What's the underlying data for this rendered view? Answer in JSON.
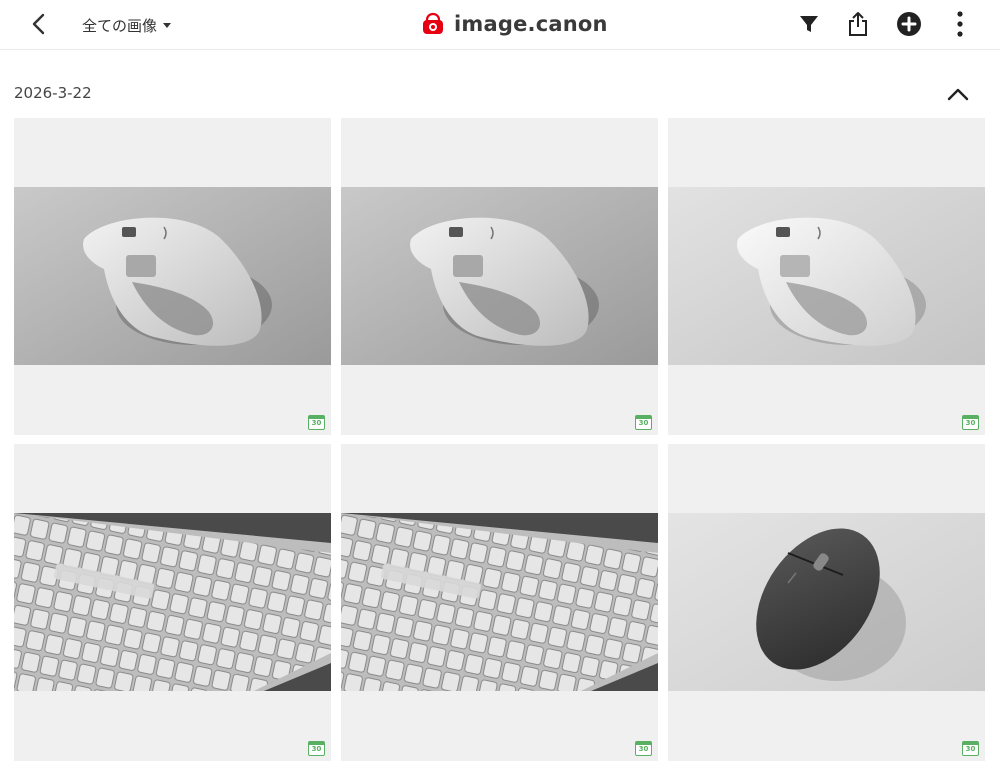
{
  "header": {
    "album_label": "全ての画像",
    "brand_name": "image.canon",
    "icons": {
      "back": "chevron-left-icon",
      "filter": "filter-icon",
      "share": "share-icon",
      "add": "plus-circle-icon",
      "more": "more-vertical-icon"
    }
  },
  "section": {
    "date": "2026-3-22",
    "collapse_icon": "chevron-up-icon"
  },
  "photos": [
    {
      "subject": "mouse-white",
      "badge": "30"
    },
    {
      "subject": "mouse-white",
      "badge": "30"
    },
    {
      "subject": "mouse-white",
      "badge": "30"
    },
    {
      "subject": "keyboard",
      "badge": "30"
    },
    {
      "subject": "keyboard",
      "badge": "30"
    },
    {
      "subject": "mouse-dark",
      "badge": "30"
    }
  ],
  "colors": {
    "brand_red": "#e60012",
    "badge_green": "#59b063",
    "tile_bg": "#f0f0f0"
  }
}
